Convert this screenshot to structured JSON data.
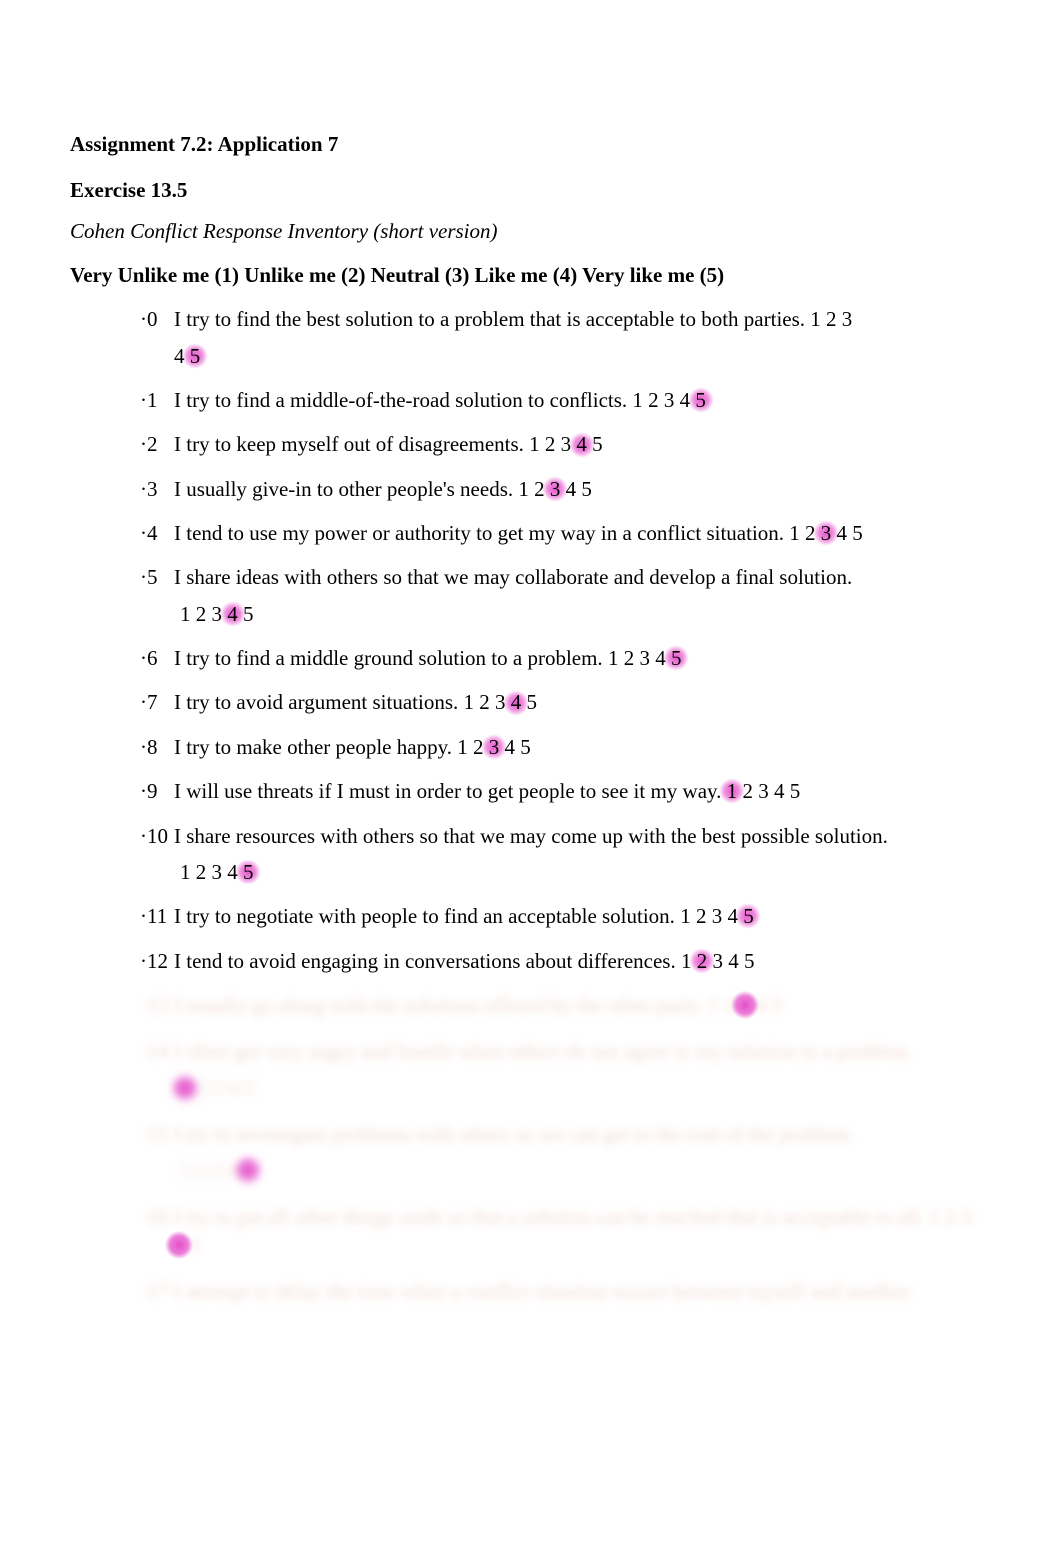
{
  "title": "Assignment 7.2: Application 7",
  "exercise": "Exercise 13.5",
  "subtitle": "Cohen Conflict Response Inventory (short version)",
  "scale": "Very Unlike me (1) Unlike me (2) Neutral (3) Like me (4) Very like me (5)",
  "items": [
    {
      "num": "·0",
      "text": "I try to find the best solution to a problem that is acceptable to both parties.",
      "ratings": [
        "1",
        "2",
        "3",
        "4",
        "5"
      ],
      "highlight": 4,
      "inline": true,
      "wrapAfter": 2
    },
    {
      "num": "·1",
      "text": "I try to find a middle-of-the-road solution to conflicts.",
      "ratings": [
        "1",
        "2",
        "3",
        "4",
        "5"
      ],
      "highlight": 4,
      "inline": true
    },
    {
      "num": "·2",
      "text": "I try to keep myself out of disagreements.",
      "ratings": [
        "1",
        "2",
        "3",
        "4",
        "5"
      ],
      "highlight": 3,
      "inline": true
    },
    {
      "num": "·3",
      "text": "I usually give-in to other people's needs.",
      "ratings": [
        "1",
        "2",
        "3",
        "4",
        "5"
      ],
      "highlight": 2,
      "inline": true
    },
    {
      "num": "·4",
      "text": "I tend to use my power or authority to get my way in a conflict situation.",
      "ratings": [
        "1",
        "2",
        "3",
        "4",
        "5"
      ],
      "highlight": 2,
      "inline": true
    },
    {
      "num": "·5",
      "text": "I share ideas with others so that we may collaborate and develop a final solution.",
      "ratings": [
        "1",
        "2",
        "3",
        "4",
        "5"
      ],
      "highlight": 3,
      "inline": false
    },
    {
      "num": "·6",
      "text": "I try to find a middle ground solution to a problem.",
      "ratings": [
        "1",
        "2",
        "3",
        "4",
        "5"
      ],
      "highlight": 4,
      "inline": true
    },
    {
      "num": "·7",
      "text": "I try to avoid argument situations.",
      "ratings": [
        "1",
        "2",
        "3",
        "4",
        "5"
      ],
      "highlight": 3,
      "inline": true
    },
    {
      "num": "·8",
      "text": "I try to make other people happy.",
      "ratings": [
        "1",
        "2",
        "3",
        "4",
        "5"
      ],
      "highlight": 2,
      "inline": true
    },
    {
      "num": "·9",
      "text": "I will use threats if I must in order to get people to see it my way.",
      "ratings": [
        "1",
        "2",
        "3",
        "4",
        "5"
      ],
      "highlight": 0,
      "inline": true
    },
    {
      "num": "·10",
      "text": "I share resources with others so that we may come up with the best possible solution.",
      "ratings": [
        "1",
        "2",
        "3",
        "4",
        "5"
      ],
      "highlight": 4,
      "inline": false
    },
    {
      "num": "·11",
      "text": "I try to negotiate with people to find an acceptable solution.",
      "ratings": [
        "1",
        "2",
        "3",
        "4",
        "5"
      ],
      "highlight": 4,
      "inline": true
    },
    {
      "num": "·12",
      "text": "I tend to avoid engaging in conversations about differences.",
      "ratings": [
        "1",
        "2",
        "3",
        "4",
        "5"
      ],
      "highlight": 1,
      "inline": true
    }
  ],
  "blurred_items": [
    {
      "num": "·13",
      "text": "I usually go along with the solutions offered by the other party.",
      "ratings_prefix": "1 2 ",
      "ratings_suffix": " 4 5",
      "highlight": "3",
      "inline": true
    },
    {
      "num": "·14",
      "text": "I often get very angry and hostile when others do not agree to my solution to a problem.",
      "ratings_prefix": "",
      "ratings_suffix": " 2 3 4 5",
      "highlight": "1",
      "inline": false
    },
    {
      "num": "·15",
      "text": "I try to investigate problems with others so we can get to the root of the problem.",
      "ratings_prefix": "1 2 3 4 ",
      "ratings_suffix": "",
      "highlight": "5",
      "inline": false
    },
    {
      "num": "·16",
      "text": "I try to put all other things aside so that a solution can be reached that is acceptable to all.",
      "ratings_prefix": "1 2 3 ",
      "ratings_suffix": " 5",
      "highlight": "4",
      "inline": true,
      "wrap_ratings": true
    },
    {
      "num": "·17",
      "text": "I attempt to delay the time when a conflict situation occurs between myself and another.",
      "ratings_prefix": "",
      "ratings_suffix": "",
      "highlight": "",
      "inline": true
    }
  ]
}
